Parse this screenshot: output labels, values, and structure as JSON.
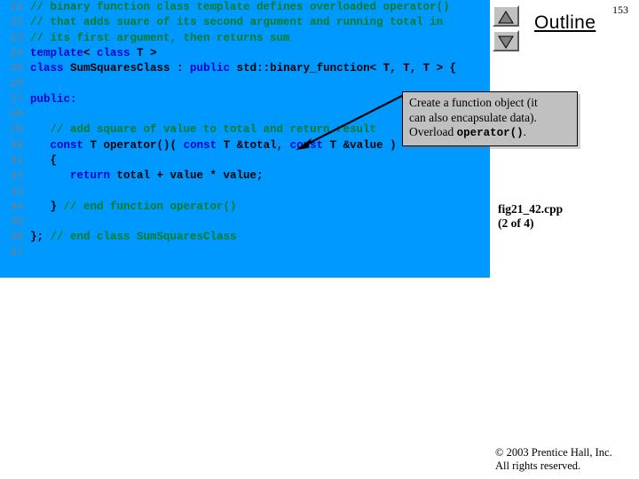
{
  "slide": {
    "number": "153",
    "outline_label": "Outline",
    "file_caption": "fig21_42.cpp",
    "file_caption_sub": "(2 of 4)"
  },
  "scroll": {
    "up_icon": "triangle-up-icon",
    "down_icon": "triangle-down-icon"
  },
  "callout": {
    "line1": "Create a function object (it",
    "line2": "can also encapsulate data).",
    "line3_prefix": "Overload ",
    "line3_code": "operator()",
    "line3_suffix": "."
  },
  "footer": {
    "line1": "© 2003 Prentice Hall, Inc.",
    "line2": "All rights reserved."
  },
  "colors": {
    "code_background": "#0099ff",
    "comment": "#007b26",
    "keyword": "#0000d0",
    "plain": "#000000",
    "line_number": "#7d7d7d",
    "callout_background": "#c0c0c0"
  },
  "code": {
    "lines": [
      {
        "n": "21",
        "segments": [
          {
            "t": "// binary function class template defines overloaded operator()",
            "c": "cmt"
          }
        ]
      },
      {
        "n": "22",
        "segments": [
          {
            "t": "// that adds suare of its second argument and running total in",
            "c": "cmt"
          }
        ]
      },
      {
        "n": "23",
        "segments": [
          {
            "t": "// its first argument, then returns sum",
            "c": "cmt"
          }
        ]
      },
      {
        "n": "24",
        "segments": [
          {
            "t": "template",
            "c": "kw"
          },
          {
            "t": "< ",
            "c": "pln"
          },
          {
            "t": "class",
            "c": "kw"
          },
          {
            "t": " T >",
            "c": "pln"
          }
        ]
      },
      {
        "n": "25",
        "segments": [
          {
            "t": "class",
            "c": "kw"
          },
          {
            "t": " SumSquaresClass : ",
            "c": "pln"
          },
          {
            "t": "public",
            "c": "kw"
          },
          {
            "t": " std::binary_function< T, T, T > {",
            "c": "pln"
          }
        ]
      },
      {
        "n": "26",
        "segments": []
      },
      {
        "n": "27",
        "segments": [
          {
            "t": "public:",
            "c": "kw"
          }
        ]
      },
      {
        "n": "28",
        "segments": []
      },
      {
        "n": "29",
        "segments": [
          {
            "t": "   // add square of value to total and return result",
            "c": "cmt"
          }
        ]
      },
      {
        "n": "30",
        "segments": [
          {
            "t": "   ",
            "c": "pln"
          },
          {
            "t": "const",
            "c": "kw"
          },
          {
            "t": " T operator()( ",
            "c": "pln"
          },
          {
            "t": "const",
            "c": "kw"
          },
          {
            "t": " T &total, ",
            "c": "pln"
          },
          {
            "t": "const",
            "c": "kw"
          },
          {
            "t": " T &value )",
            "c": "pln"
          }
        ]
      },
      {
        "n": "31",
        "segments": [
          {
            "t": "   {",
            "c": "pln"
          }
        ]
      },
      {
        "n": "32",
        "segments": [
          {
            "t": "      ",
            "c": "pln"
          },
          {
            "t": "return",
            "c": "kw"
          },
          {
            "t": " total + value * value;",
            "c": "pln"
          }
        ]
      },
      {
        "n": "33",
        "segments": []
      },
      {
        "n": "34",
        "segments": [
          {
            "t": "   }",
            "c": "pln"
          },
          {
            "t": " // end function operator()",
            "c": "cmt"
          }
        ]
      },
      {
        "n": "35",
        "segments": []
      },
      {
        "n": "36",
        "segments": [
          {
            "t": "};",
            "c": "pln"
          },
          {
            "t": " // end class SumSquaresClass",
            "c": "cmt"
          }
        ]
      },
      {
        "n": "37",
        "segments": []
      }
    ]
  }
}
